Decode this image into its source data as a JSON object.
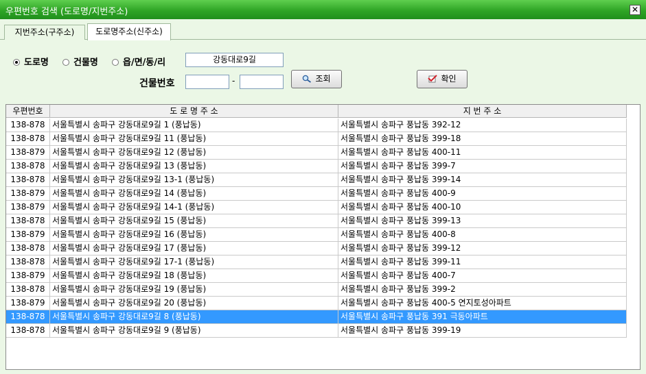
{
  "window": {
    "title": "우편번호 검색 (도로명/지번주소)",
    "close_label": "✕"
  },
  "tabs": [
    {
      "label": "지번주소(구주소)"
    },
    {
      "label": "도로명주소(신주소)"
    }
  ],
  "search": {
    "radios": [
      {
        "label": "도로명",
        "checked": true
      },
      {
        "label": "건물명",
        "checked": false
      },
      {
        "label": "읍/면/동/리",
        "checked": false
      }
    ],
    "road_value": "강동대로9길",
    "building_label": "건물번호",
    "building_num1": "",
    "building_num2": "",
    "dash": "-",
    "search_button": "조회",
    "ok_button": "확인"
  },
  "table": {
    "columns": [
      "우편번호",
      "도 로 명 주 소",
      "지 번 주 소"
    ],
    "selected_index": 14,
    "rows": [
      [
        "138-878",
        "서울특별시 송파구 강동대로9길 1 (풍납동)",
        "서울특별시 송파구 풍납동 392-12"
      ],
      [
        "138-878",
        "서울특별시 송파구 강동대로9길 11 (풍납동)",
        "서울특별시 송파구 풍납동 399-18"
      ],
      [
        "138-879",
        "서울특별시 송파구 강동대로9길 12 (풍납동)",
        "서울특별시 송파구 풍납동 400-11"
      ],
      [
        "138-878",
        "서울특별시 송파구 강동대로9길 13 (풍납동)",
        "서울특별시 송파구 풍납동 399-7"
      ],
      [
        "138-878",
        "서울특별시 송파구 강동대로9길 13-1 (풍납동)",
        "서울특별시 송파구 풍납동 399-14"
      ],
      [
        "138-879",
        "서울특별시 송파구 강동대로9길 14 (풍납동)",
        "서울특별시 송파구 풍납동 400-9"
      ],
      [
        "138-879",
        "서울특별시 송파구 강동대로9길 14-1 (풍납동)",
        "서울특별시 송파구 풍납동 400-10"
      ],
      [
        "138-878",
        "서울특별시 송파구 강동대로9길 15 (풍납동)",
        "서울특별시 송파구 풍납동 399-13"
      ],
      [
        "138-879",
        "서울특별시 송파구 강동대로9길 16 (풍납동)",
        "서울특별시 송파구 풍납동 400-8"
      ],
      [
        "138-878",
        "서울특별시 송파구 강동대로9길 17 (풍납동)",
        "서울특별시 송파구 풍납동 399-12"
      ],
      [
        "138-878",
        "서울특별시 송파구 강동대로9길 17-1 (풍납동)",
        "서울특별시 송파구 풍납동 399-11"
      ],
      [
        "138-879",
        "서울특별시 송파구 강동대로9길 18 (풍납동)",
        "서울특별시 송파구 풍납동 400-7"
      ],
      [
        "138-878",
        "서울특별시 송파구 강동대로9길 19 (풍납동)",
        "서울특별시 송파구 풍납동 399-2"
      ],
      [
        "138-879",
        "서울특별시 송파구 강동대로9길 20 (풍납동)",
        "서울특별시 송파구 풍납동 400-5 연지토성아파트"
      ],
      [
        "138-878",
        "서울특별시 송파구 강동대로9길 8 (풍납동)",
        "서울특별시 송파구 풍납동 391 극동아파트"
      ],
      [
        "138-878",
        "서울특별시 송파구 강동대로9길 9 (풍납동)",
        "서울특별시 송파구 풍납동 399-19"
      ]
    ]
  },
  "colors": {
    "titlebar": "#2fa526",
    "background": "#ebf7e6",
    "selection": "#3399ff"
  }
}
